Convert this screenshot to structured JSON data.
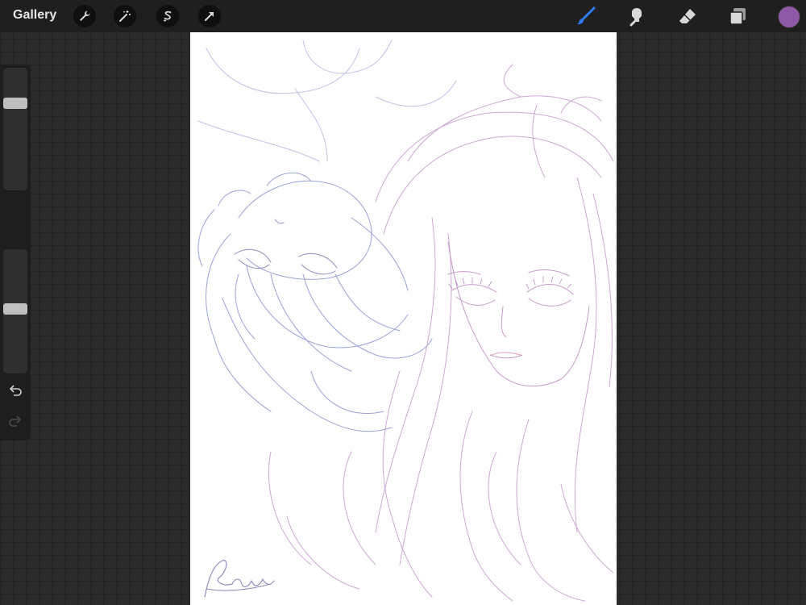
{
  "app": {
    "gallery_label": "Gallery"
  },
  "toolbar": {
    "left_tools": [
      "wrench-icon",
      "magic-wand-icon",
      "selection-s-icon",
      "transform-arrow-icon"
    ],
    "right_tools": [
      "brush-icon",
      "smudge-icon",
      "eraser-icon",
      "layers-icon"
    ],
    "active_tool": "brush",
    "current_color": "#8e5aa6"
  },
  "sidebar": {
    "brush_size_level": 0.73,
    "opacity_level": 0.52,
    "icons": [
      "modify-square-icon",
      "undo-icon",
      "redo-icon"
    ]
  },
  "colors": {
    "accent_active": "#2f7bf6",
    "sketch_blue": "#9aa2d6",
    "sketch_pink": "#c9a3cf"
  },
  "canvas": {
    "content": "pencil-sketch",
    "signature": "Kuyalio"
  }
}
